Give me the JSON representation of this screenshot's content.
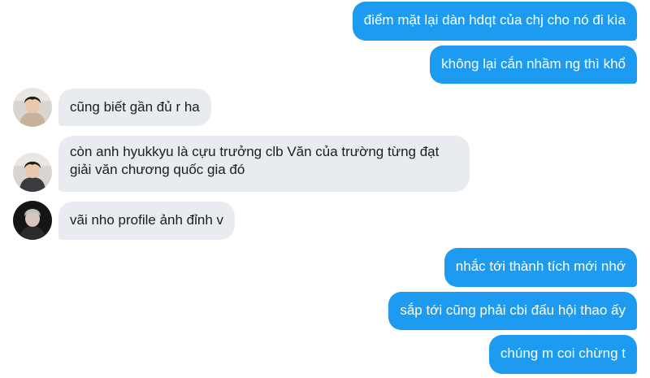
{
  "messages": [
    {
      "side": "out",
      "text": "điểm mặt lại dàn hdqt của chj cho nó đi kìa"
    },
    {
      "side": "out",
      "text": "không lại cắn nhầm ng thì khổ"
    },
    {
      "side": "in",
      "sender": "friend-1",
      "text": "cũng biết gần đủ r ha"
    },
    {
      "side": "in",
      "sender": "friend-1",
      "text": "còn anh hyukkyu là cựu trưởng clb Văn của trường từng đạt giải văn chương quốc gia đó"
    },
    {
      "side": "in",
      "sender": "friend-2",
      "text": "vãi nho profile ảnh đỉnh v"
    },
    {
      "side": "out",
      "text": "nhắc tới thành tích mới nhớ"
    },
    {
      "side": "out",
      "text": "sắp tới cũng phải cbi đấu hội thao ấy"
    },
    {
      "side": "out",
      "text": "chúng m coi chừng t"
    }
  ],
  "colors": {
    "outgoing_bubble": "#1d9bf0",
    "incoming_bubble": "#e8ebef",
    "outgoing_text": "#ffffff",
    "incoming_text": "#1a1d21"
  },
  "avatars": {
    "friend-1": "person-photo-avatar",
    "friend-2": "person-photo-avatar-dark"
  }
}
